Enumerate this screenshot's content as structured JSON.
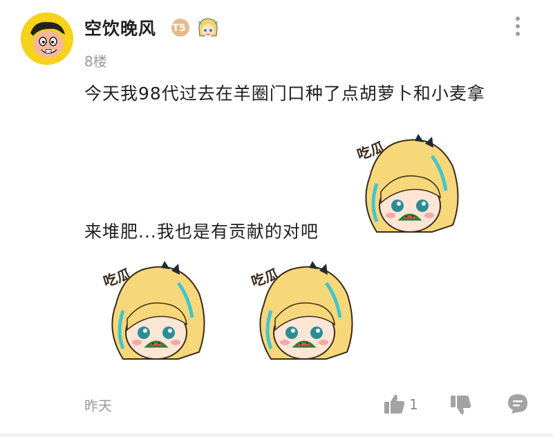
{
  "post": {
    "username": "空饮晚风",
    "level_badge": "T5",
    "floor": "8楼",
    "lines": [
      "今天我98代过去在羊圈门口种了点胡萝卜和小麦拿",
      "来堆肥...我也是有贡献的对吧"
    ],
    "sticker_caption": "吃瓜…",
    "timestamp": "昨天",
    "like_count": "1"
  },
  "colors": {
    "avatar_bg": "#f7d21a",
    "badge": "#e8b98a",
    "secondary_text": "#9a9a9a",
    "icon_gray": "#9d9d9d"
  },
  "icons": [
    "more-vertical-icon",
    "thumbs-up-icon",
    "thumbs-down-icon",
    "comment-icon"
  ]
}
